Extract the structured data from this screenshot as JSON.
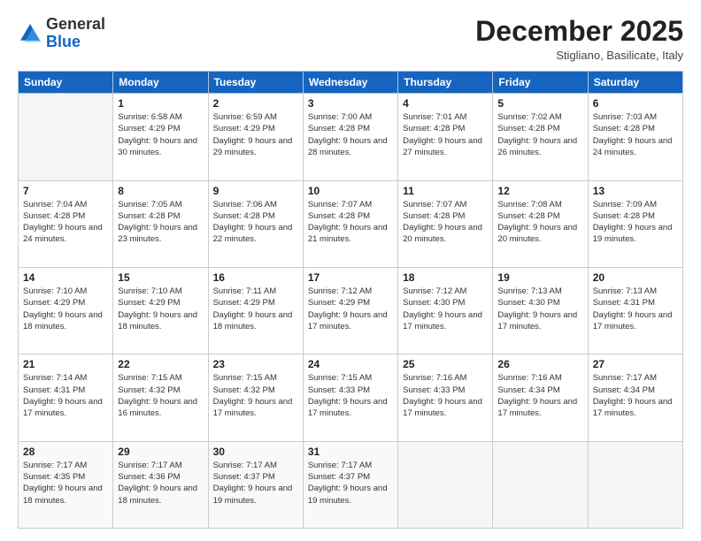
{
  "logo": {
    "general": "General",
    "blue": "Blue"
  },
  "header": {
    "month": "December 2025",
    "location": "Stigliano, Basilicate, Italy"
  },
  "weekdays": [
    "Sunday",
    "Monday",
    "Tuesday",
    "Wednesday",
    "Thursday",
    "Friday",
    "Saturday"
  ],
  "weeks": [
    [
      {
        "day": "",
        "empty": true
      },
      {
        "day": "1",
        "sunrise": "Sunrise: 6:58 AM",
        "sunset": "Sunset: 4:29 PM",
        "daylight": "Daylight: 9 hours and 30 minutes."
      },
      {
        "day": "2",
        "sunrise": "Sunrise: 6:59 AM",
        "sunset": "Sunset: 4:29 PM",
        "daylight": "Daylight: 9 hours and 29 minutes."
      },
      {
        "day": "3",
        "sunrise": "Sunrise: 7:00 AM",
        "sunset": "Sunset: 4:28 PM",
        "daylight": "Daylight: 9 hours and 28 minutes."
      },
      {
        "day": "4",
        "sunrise": "Sunrise: 7:01 AM",
        "sunset": "Sunset: 4:28 PM",
        "daylight": "Daylight: 9 hours and 27 minutes."
      },
      {
        "day": "5",
        "sunrise": "Sunrise: 7:02 AM",
        "sunset": "Sunset: 4:28 PM",
        "daylight": "Daylight: 9 hours and 26 minutes."
      },
      {
        "day": "6",
        "sunrise": "Sunrise: 7:03 AM",
        "sunset": "Sunset: 4:28 PM",
        "daylight": "Daylight: 9 hours and 24 minutes."
      }
    ],
    [
      {
        "day": "7",
        "sunrise": "Sunrise: 7:04 AM",
        "sunset": "Sunset: 4:28 PM",
        "daylight": "Daylight: 9 hours and 24 minutes."
      },
      {
        "day": "8",
        "sunrise": "Sunrise: 7:05 AM",
        "sunset": "Sunset: 4:28 PM",
        "daylight": "Daylight: 9 hours and 23 minutes."
      },
      {
        "day": "9",
        "sunrise": "Sunrise: 7:06 AM",
        "sunset": "Sunset: 4:28 PM",
        "daylight": "Daylight: 9 hours and 22 minutes."
      },
      {
        "day": "10",
        "sunrise": "Sunrise: 7:07 AM",
        "sunset": "Sunset: 4:28 PM",
        "daylight": "Daylight: 9 hours and 21 minutes."
      },
      {
        "day": "11",
        "sunrise": "Sunrise: 7:07 AM",
        "sunset": "Sunset: 4:28 PM",
        "daylight": "Daylight: 9 hours and 20 minutes."
      },
      {
        "day": "12",
        "sunrise": "Sunrise: 7:08 AM",
        "sunset": "Sunset: 4:28 PM",
        "daylight": "Daylight: 9 hours and 20 minutes."
      },
      {
        "day": "13",
        "sunrise": "Sunrise: 7:09 AM",
        "sunset": "Sunset: 4:28 PM",
        "daylight": "Daylight: 9 hours and 19 minutes."
      }
    ],
    [
      {
        "day": "14",
        "sunrise": "Sunrise: 7:10 AM",
        "sunset": "Sunset: 4:29 PM",
        "daylight": "Daylight: 9 hours and 18 minutes."
      },
      {
        "day": "15",
        "sunrise": "Sunrise: 7:10 AM",
        "sunset": "Sunset: 4:29 PM",
        "daylight": "Daylight: 9 hours and 18 minutes."
      },
      {
        "day": "16",
        "sunrise": "Sunrise: 7:11 AM",
        "sunset": "Sunset: 4:29 PM",
        "daylight": "Daylight: 9 hours and 18 minutes."
      },
      {
        "day": "17",
        "sunrise": "Sunrise: 7:12 AM",
        "sunset": "Sunset: 4:29 PM",
        "daylight": "Daylight: 9 hours and 17 minutes."
      },
      {
        "day": "18",
        "sunrise": "Sunrise: 7:12 AM",
        "sunset": "Sunset: 4:30 PM",
        "daylight": "Daylight: 9 hours and 17 minutes."
      },
      {
        "day": "19",
        "sunrise": "Sunrise: 7:13 AM",
        "sunset": "Sunset: 4:30 PM",
        "daylight": "Daylight: 9 hours and 17 minutes."
      },
      {
        "day": "20",
        "sunrise": "Sunrise: 7:13 AM",
        "sunset": "Sunset: 4:31 PM",
        "daylight": "Daylight: 9 hours and 17 minutes."
      }
    ],
    [
      {
        "day": "21",
        "sunrise": "Sunrise: 7:14 AM",
        "sunset": "Sunset: 4:31 PM",
        "daylight": "Daylight: 9 hours and 17 minutes."
      },
      {
        "day": "22",
        "sunrise": "Sunrise: 7:15 AM",
        "sunset": "Sunset: 4:32 PM",
        "daylight": "Daylight: 9 hours and 16 minutes."
      },
      {
        "day": "23",
        "sunrise": "Sunrise: 7:15 AM",
        "sunset": "Sunset: 4:32 PM",
        "daylight": "Daylight: 9 hours and 17 minutes."
      },
      {
        "day": "24",
        "sunrise": "Sunrise: 7:15 AM",
        "sunset": "Sunset: 4:33 PM",
        "daylight": "Daylight: 9 hours and 17 minutes."
      },
      {
        "day": "25",
        "sunrise": "Sunrise: 7:16 AM",
        "sunset": "Sunset: 4:33 PM",
        "daylight": "Daylight: 9 hours and 17 minutes."
      },
      {
        "day": "26",
        "sunrise": "Sunrise: 7:16 AM",
        "sunset": "Sunset: 4:34 PM",
        "daylight": "Daylight: 9 hours and 17 minutes."
      },
      {
        "day": "27",
        "sunrise": "Sunrise: 7:17 AM",
        "sunset": "Sunset: 4:34 PM",
        "daylight": "Daylight: 9 hours and 17 minutes."
      }
    ],
    [
      {
        "day": "28",
        "sunrise": "Sunrise: 7:17 AM",
        "sunset": "Sunset: 4:35 PM",
        "daylight": "Daylight: 9 hours and 18 minutes."
      },
      {
        "day": "29",
        "sunrise": "Sunrise: 7:17 AM",
        "sunset": "Sunset: 4:36 PM",
        "daylight": "Daylight: 9 hours and 18 minutes."
      },
      {
        "day": "30",
        "sunrise": "Sunrise: 7:17 AM",
        "sunset": "Sunset: 4:37 PM",
        "daylight": "Daylight: 9 hours and 19 minutes."
      },
      {
        "day": "31",
        "sunrise": "Sunrise: 7:17 AM",
        "sunset": "Sunset: 4:37 PM",
        "daylight": "Daylight: 9 hours and 19 minutes."
      },
      {
        "day": "",
        "empty": true
      },
      {
        "day": "",
        "empty": true
      },
      {
        "day": "",
        "empty": true
      }
    ]
  ]
}
